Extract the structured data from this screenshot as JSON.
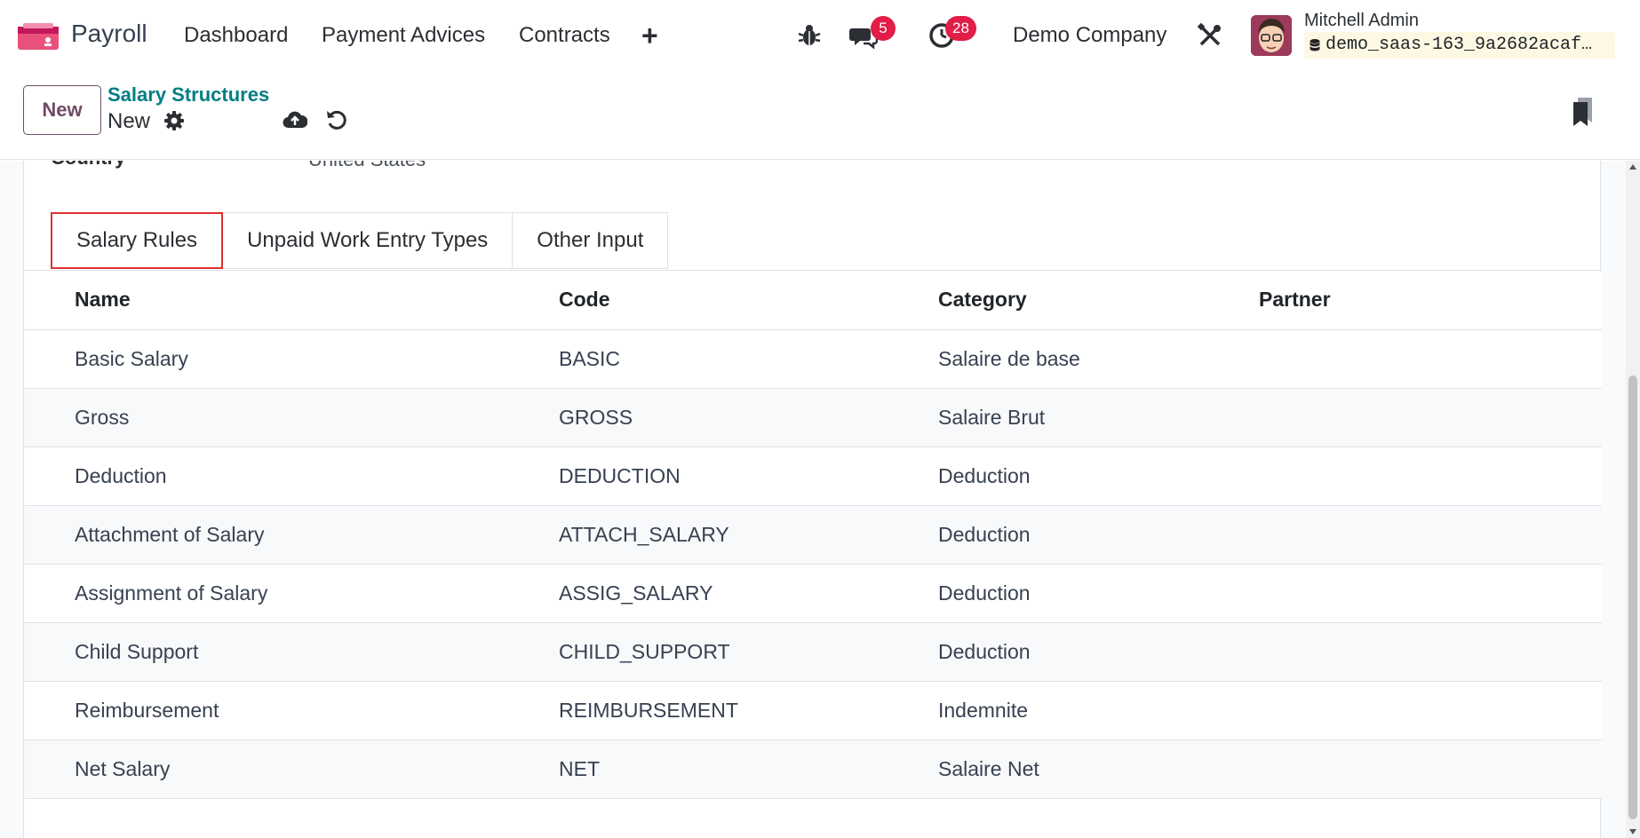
{
  "navbar": {
    "app_name": "Payroll",
    "menu": [
      "Dashboard",
      "Payment Advices",
      "Contracts"
    ],
    "add_icon": "plus-icon",
    "messages_count": "5",
    "activities_count": "28",
    "company": "Demo Company",
    "user_name": "Mitchell Admin",
    "database": "demo_saas-163_9a2682acaf…"
  },
  "control_panel": {
    "new_label": "New",
    "breadcrumb": "Salary Structures",
    "record_title": "New"
  },
  "form": {
    "country_label": "Country",
    "country_value": "United States"
  },
  "tabs": [
    "Salary Rules",
    "Unpaid Work Entry Types",
    "Other Input"
  ],
  "table": {
    "headers": [
      "Name",
      "Code",
      "Category",
      "Partner"
    ],
    "rows": [
      [
        "Basic Salary",
        "BASIC",
        "Salaire de base",
        ""
      ],
      [
        "Gross",
        "GROSS",
        "Salaire Brut",
        ""
      ],
      [
        "Deduction",
        "DEDUCTION",
        "Deduction",
        ""
      ],
      [
        "Attachment of Salary",
        "ATTACH_SALARY",
        "Deduction",
        ""
      ],
      [
        "Assignment of Salary",
        "ASSIG_SALARY",
        "Deduction",
        ""
      ],
      [
        "Child Support",
        "CHILD_SUPPORT",
        "Deduction",
        ""
      ],
      [
        "Reimbursement",
        "REIMBURSEMENT",
        "Indemnite",
        ""
      ],
      [
        "Net Salary",
        "NET",
        "Salaire Net",
        ""
      ]
    ]
  },
  "colors": {
    "brand": "#714B67",
    "breadcrumb": "#017e84",
    "badge": "#e11d48",
    "active_tab_outline": "#e03131"
  }
}
